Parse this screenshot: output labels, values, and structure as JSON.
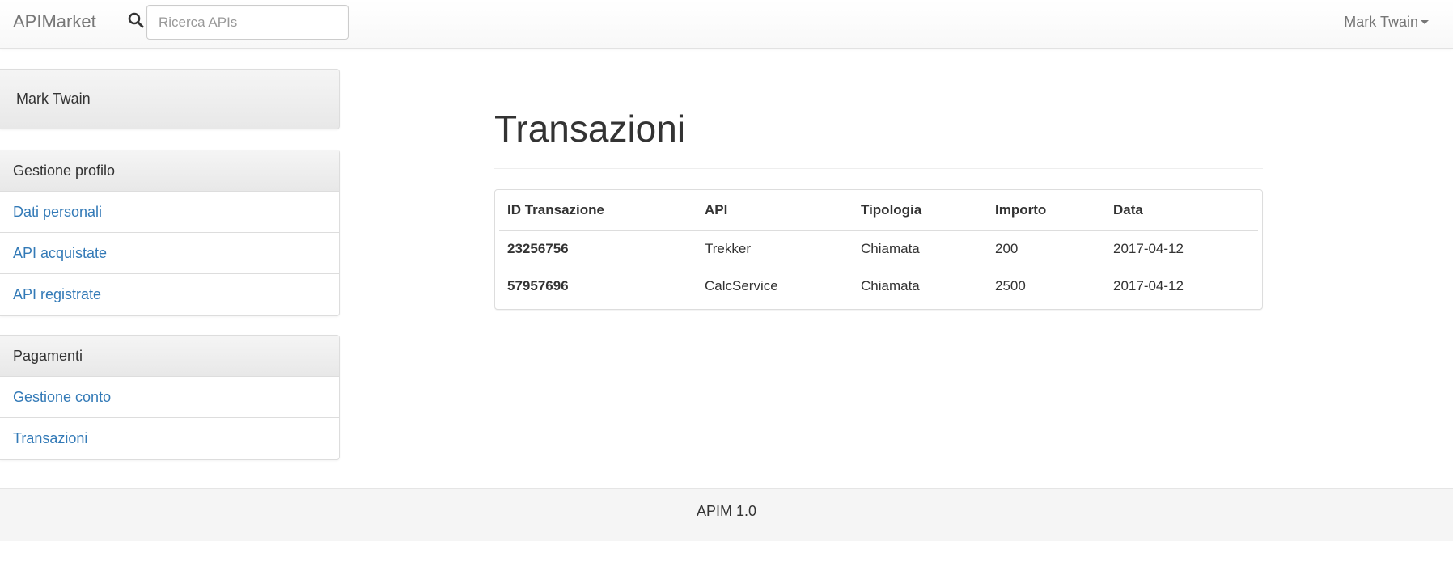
{
  "navbar": {
    "brand": "APIMarket",
    "search": {
      "placeholder": "Ricerca APIs",
      "value": ""
    },
    "user_menu": "Mark Twain"
  },
  "sidebar": {
    "user_name": "Mark Twain",
    "profile_panel": {
      "heading": "Gestione profilo",
      "items": [
        {
          "label": "Dati personali"
        },
        {
          "label": "API acquistate"
        },
        {
          "label": "API registrate"
        }
      ]
    },
    "payments_panel": {
      "heading": "Pagamenti",
      "items": [
        {
          "label": "Gestione conto"
        },
        {
          "label": "Transazioni"
        }
      ]
    }
  },
  "main": {
    "title": "Transazioni",
    "table": {
      "headers": [
        "ID Transazione",
        "API",
        "Tipologia",
        "Importo",
        "Data"
      ],
      "rows": [
        [
          "23256756",
          "Trekker",
          "Chiamata",
          "200",
          "2017-04-12"
        ],
        [
          "57957696",
          "CalcService",
          "Chiamata",
          "2500",
          "2017-04-12"
        ]
      ]
    }
  },
  "footer": {
    "text": "APIM 1.0"
  },
  "colors": {
    "link": "#337ab7",
    "text": "#333333",
    "navbar_text": "#777777",
    "panel_border": "#dddddd",
    "footer_bg": "#f5f5f5"
  },
  "icons": {
    "search": "search-icon",
    "user_menu_caret": "caret-down-icon"
  }
}
